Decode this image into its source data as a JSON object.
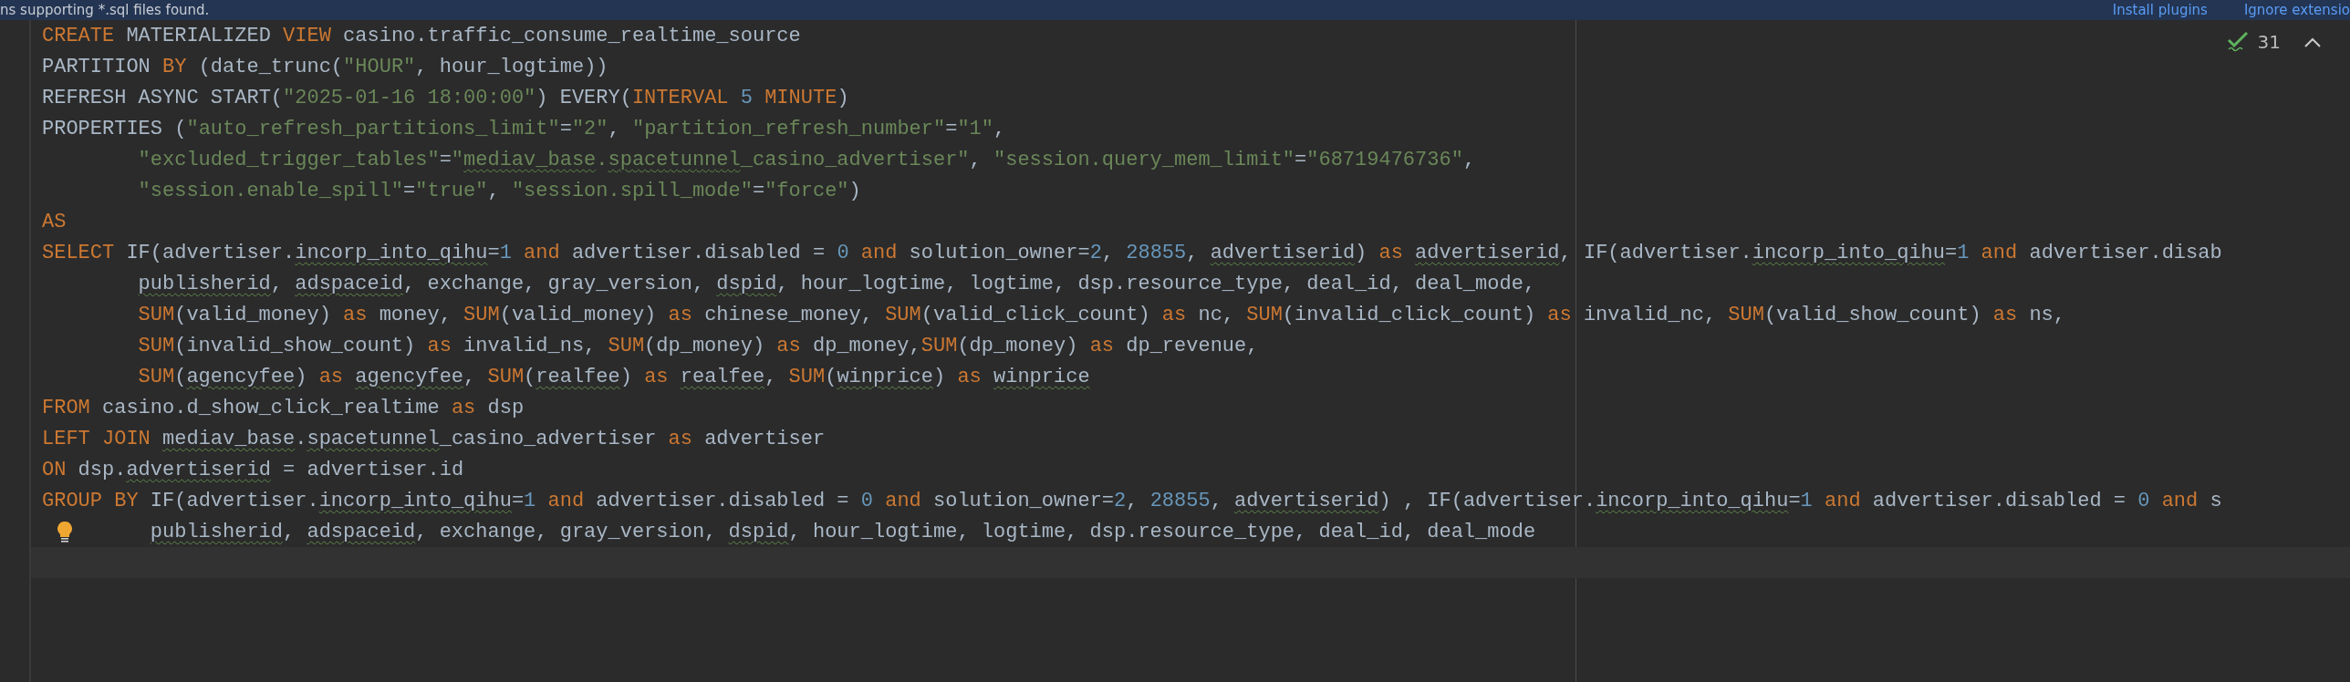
{
  "banner": {
    "message": "ns supporting *.sql files found.",
    "actions": [
      "Install plugins",
      "Ignore extensio"
    ]
  },
  "inspections": {
    "count": "31"
  },
  "lines": [
    {
      "kind": "statement",
      "current": false,
      "hint": false,
      "segments": [
        {
          "kind": "kw",
          "text": "CREATE"
        },
        {
          "kind": "txt",
          "text": " MATERIALIZED "
        },
        {
          "kind": "kw",
          "text": "VIEW"
        },
        {
          "kind": "txt",
          "text": " casino.traffic_consume_realtime_source"
        }
      ]
    },
    {
      "kind": "statement",
      "current": false,
      "hint": false,
      "segments": [
        {
          "kind": "txt",
          "text": "PARTITION "
        },
        {
          "kind": "kw",
          "text": "BY"
        },
        {
          "kind": "txt",
          "text": " (date_trunc("
        },
        {
          "kind": "str",
          "text": "\"HOUR\""
        },
        {
          "kind": "txt",
          "text": ", hour_logtime))"
        }
      ]
    },
    {
      "kind": "statement",
      "current": false,
      "hint": false,
      "segments": [
        {
          "kind": "txt",
          "text": "REFRESH ASYNC START("
        },
        {
          "kind": "str",
          "text": "\"2025-01-16 18:00:00\""
        },
        {
          "kind": "txt",
          "text": ") EVERY("
        },
        {
          "kind": "kw",
          "text": "INTERVAL"
        },
        {
          "kind": "num",
          "text": " 5"
        },
        {
          "kind": "kw",
          "text": " MINUTE"
        },
        {
          "kind": "txt",
          "text": ")"
        }
      ]
    },
    {
      "kind": "statement",
      "current": false,
      "hint": false,
      "segments": [
        {
          "kind": "txt",
          "text": "PROPERTIES ("
        },
        {
          "kind": "str",
          "text": "\"auto_refresh_partitions_limit\""
        },
        {
          "kind": "txt",
          "text": "="
        },
        {
          "kind": "str",
          "text": "\"2\""
        },
        {
          "kind": "txt",
          "text": ", "
        },
        {
          "kind": "str",
          "text": "\"partition_refresh_number\""
        },
        {
          "kind": "txt",
          "text": "="
        },
        {
          "kind": "str",
          "text": "\"1\""
        },
        {
          "kind": "txt",
          "text": ","
        }
      ]
    },
    {
      "kind": "wrapped",
      "current": false,
      "hint": false,
      "segments": [
        {
          "kind": "str",
          "text": "\"excluded_trigger_tables\""
        },
        {
          "kind": "txt",
          "text": "="
        },
        {
          "kind": "str",
          "text": "\""
        },
        {
          "kind": "strwarn",
          "text": "mediav_base"
        },
        {
          "kind": "str",
          "text": "."
        },
        {
          "kind": "strwarn",
          "text": "spacetunnel"
        },
        {
          "kind": "str",
          "text": "_casino_advertiser\""
        },
        {
          "kind": "txt",
          "text": ", "
        },
        {
          "kind": "str",
          "text": "\"session.query_mem_limit\""
        },
        {
          "kind": "txt",
          "text": "="
        },
        {
          "kind": "str",
          "text": "\"68719476736\""
        },
        {
          "kind": "txt",
          "text": ","
        }
      ]
    },
    {
      "kind": "wrapped",
      "current": false,
      "hint": false,
      "segments": [
        {
          "kind": "str",
          "text": "\"session.enable_spill\""
        },
        {
          "kind": "txt",
          "text": "="
        },
        {
          "kind": "str",
          "text": "\"true\""
        },
        {
          "kind": "txt",
          "text": ", "
        },
        {
          "kind": "str",
          "text": "\"session.spill_mode\""
        },
        {
          "kind": "txt",
          "text": "="
        },
        {
          "kind": "str",
          "text": "\"force\""
        },
        {
          "kind": "txt",
          "text": ")"
        }
      ]
    },
    {
      "kind": "statement",
      "current": false,
      "hint": false,
      "segments": [
        {
          "kind": "kw",
          "text": "AS"
        }
      ]
    },
    {
      "kind": "statement",
      "current": false,
      "hint": false,
      "segments": [
        {
          "kind": "kw",
          "text": "SELECT"
        },
        {
          "kind": "txt",
          "text": " IF(advertiser."
        },
        {
          "kind": "warn",
          "text": "incorp_into_qihu"
        },
        {
          "kind": "txt",
          "text": "="
        },
        {
          "kind": "num",
          "text": "1"
        },
        {
          "kind": "kw",
          "text": " and"
        },
        {
          "kind": "txt",
          "text": " advertiser.disabled = "
        },
        {
          "kind": "num",
          "text": "0"
        },
        {
          "kind": "kw",
          "text": " and"
        },
        {
          "kind": "txt",
          "text": " solution_owner="
        },
        {
          "kind": "num",
          "text": "2"
        },
        {
          "kind": "txt",
          "text": ", "
        },
        {
          "kind": "num",
          "text": "28855"
        },
        {
          "kind": "txt",
          "text": ", "
        },
        {
          "kind": "warn",
          "text": "advertiserid"
        },
        {
          "kind": "txt",
          "text": ") "
        },
        {
          "kind": "kw",
          "text": "as "
        },
        {
          "kind": "warn",
          "text": "advertiserid"
        },
        {
          "kind": "txt",
          "text": ", IF(advertiser."
        },
        {
          "kind": "warn",
          "text": "incorp_into_qihu"
        },
        {
          "kind": "txt",
          "text": "="
        },
        {
          "kind": "num",
          "text": "1"
        },
        {
          "kind": "kw",
          "text": " and"
        },
        {
          "kind": "txt",
          "text": " advertiser.disab"
        }
      ]
    },
    {
      "kind": "wrapped",
      "current": false,
      "hint": false,
      "segments": [
        {
          "kind": "warn",
          "text": "publisherid"
        },
        {
          "kind": "txt",
          "text": ", "
        },
        {
          "kind": "warn",
          "text": "adspaceid"
        },
        {
          "kind": "txt",
          "text": ", exchange, gray_version, "
        },
        {
          "kind": "warn",
          "text": "dspid"
        },
        {
          "kind": "txt",
          "text": ", hour_logtime, logtime, dsp.resource_type, deal_id, deal_mode,"
        }
      ]
    },
    {
      "kind": "wrapped",
      "current": false,
      "hint": false,
      "segments": [
        {
          "kind": "kw",
          "text": "SUM"
        },
        {
          "kind": "txt",
          "text": "(valid_money) "
        },
        {
          "kind": "kw",
          "text": "as"
        },
        {
          "kind": "txt",
          "text": " money, "
        },
        {
          "kind": "kw",
          "text": "SUM"
        },
        {
          "kind": "txt",
          "text": "(valid_money) "
        },
        {
          "kind": "kw",
          "text": "as"
        },
        {
          "kind": "txt",
          "text": " chinese_money, "
        },
        {
          "kind": "kw",
          "text": "SUM"
        },
        {
          "kind": "txt",
          "text": "(valid_click_count) "
        },
        {
          "kind": "kw",
          "text": "as"
        },
        {
          "kind": "txt",
          "text": " nc, "
        },
        {
          "kind": "kw",
          "text": "SUM"
        },
        {
          "kind": "txt",
          "text": "(invalid_click_count) "
        },
        {
          "kind": "kw",
          "text": "as"
        },
        {
          "kind": "txt",
          "text": " invalid_nc, "
        },
        {
          "kind": "kw",
          "text": "SUM"
        },
        {
          "kind": "txt",
          "text": "(valid_show_count) "
        },
        {
          "kind": "kw",
          "text": "as"
        },
        {
          "kind": "txt",
          "text": " ns,"
        }
      ]
    },
    {
      "kind": "wrapped",
      "current": false,
      "hint": false,
      "segments": [
        {
          "kind": "kw",
          "text": "SUM"
        },
        {
          "kind": "txt",
          "text": "(invalid_show_count) "
        },
        {
          "kind": "kw",
          "text": "as"
        },
        {
          "kind": "txt",
          "text": " invalid_ns, "
        },
        {
          "kind": "kw",
          "text": "SUM"
        },
        {
          "kind": "txt",
          "text": "(dp_money) "
        },
        {
          "kind": "kw",
          "text": "as"
        },
        {
          "kind": "txt",
          "text": " dp_money,"
        },
        {
          "kind": "kw",
          "text": "SUM"
        },
        {
          "kind": "txt",
          "text": "(dp_money) "
        },
        {
          "kind": "kw",
          "text": "as"
        },
        {
          "kind": "txt",
          "text": " dp_revenue,"
        }
      ]
    },
    {
      "kind": "wrapped",
      "current": false,
      "hint": false,
      "segments": [
        {
          "kind": "kw",
          "text": "SUM"
        },
        {
          "kind": "txt",
          "text": "("
        },
        {
          "kind": "warn",
          "text": "agencyfee"
        },
        {
          "kind": "txt",
          "text": ") "
        },
        {
          "kind": "kw",
          "text": "as "
        },
        {
          "kind": "warn",
          "text": "agencyfee"
        },
        {
          "kind": "txt",
          "text": ", "
        },
        {
          "kind": "kw",
          "text": "SUM"
        },
        {
          "kind": "txt",
          "text": "("
        },
        {
          "kind": "warn",
          "text": "realfee"
        },
        {
          "kind": "txt",
          "text": ") "
        },
        {
          "kind": "kw",
          "text": "as "
        },
        {
          "kind": "warn",
          "text": "realfee"
        },
        {
          "kind": "txt",
          "text": ", "
        },
        {
          "kind": "kw",
          "text": "SUM"
        },
        {
          "kind": "txt",
          "text": "("
        },
        {
          "kind": "warn",
          "text": "winprice"
        },
        {
          "kind": "txt",
          "text": ") "
        },
        {
          "kind": "kw",
          "text": "as "
        },
        {
          "kind": "warn",
          "text": "winprice"
        }
      ]
    },
    {
      "kind": "statement",
      "current": false,
      "hint": false,
      "segments": [
        {
          "kind": "kw",
          "text": "FROM"
        },
        {
          "kind": "txt",
          "text": " casino.d_show_click_realtime "
        },
        {
          "kind": "kw",
          "text": "as"
        },
        {
          "kind": "txt",
          "text": " dsp"
        }
      ]
    },
    {
      "kind": "statement",
      "current": false,
      "hint": false,
      "segments": [
        {
          "kind": "kw",
          "text": "LEFT JOIN "
        },
        {
          "kind": "warn",
          "text": "mediav_base"
        },
        {
          "kind": "txt",
          "text": "."
        },
        {
          "kind": "warn",
          "text": "spacetunnel"
        },
        {
          "kind": "txt",
          "text": "_casino_advertiser "
        },
        {
          "kind": "kw",
          "text": "as"
        },
        {
          "kind": "txt",
          "text": " advertiser"
        }
      ]
    },
    {
      "kind": "statement",
      "current": false,
      "hint": false,
      "segments": [
        {
          "kind": "kw",
          "text": "ON"
        },
        {
          "kind": "txt",
          "text": " dsp."
        },
        {
          "kind": "warn",
          "text": "advertiserid"
        },
        {
          "kind": "txt",
          "text": " = advertiser.id"
        }
      ]
    },
    {
      "kind": "statement",
      "current": false,
      "hint": false,
      "segments": [
        {
          "kind": "kw",
          "text": "GROUP BY"
        },
        {
          "kind": "txt",
          "text": " IF(advertiser."
        },
        {
          "kind": "warn",
          "text": "incorp_into_qihu"
        },
        {
          "kind": "txt",
          "text": "="
        },
        {
          "kind": "num",
          "text": "1"
        },
        {
          "kind": "kw",
          "text": " and"
        },
        {
          "kind": "txt",
          "text": " advertiser.disabled = "
        },
        {
          "kind": "num",
          "text": "0"
        },
        {
          "kind": "kw",
          "text": " and"
        },
        {
          "kind": "txt",
          "text": " solution_owner="
        },
        {
          "kind": "num",
          "text": "2"
        },
        {
          "kind": "txt",
          "text": ", "
        },
        {
          "kind": "num",
          "text": "28855"
        },
        {
          "kind": "txt",
          "text": ", "
        },
        {
          "kind": "warn",
          "text": "advertiserid"
        },
        {
          "kind": "txt",
          "text": ") , IF(advertiser."
        },
        {
          "kind": "warn",
          "text": "incorp_into_qihu"
        },
        {
          "kind": "txt",
          "text": "="
        },
        {
          "kind": "num",
          "text": "1"
        },
        {
          "kind": "kw",
          "text": " and"
        },
        {
          "kind": "txt",
          "text": " advertiser.disabled = "
        },
        {
          "kind": "num",
          "text": "0"
        },
        {
          "kind": "kw",
          "text": " and"
        },
        {
          "kind": "txt",
          "text": " s"
        }
      ]
    },
    {
      "kind": "aligned",
      "current": false,
      "hint": true,
      "segments": [
        {
          "kind": "warn",
          "text": "publisherid"
        },
        {
          "kind": "txt",
          "text": ", "
        },
        {
          "kind": "warn",
          "text": "adspaceid"
        },
        {
          "kind": "txt",
          "text": ", exchange, gray_version, "
        },
        {
          "kind": "warn",
          "text": "dspid"
        },
        {
          "kind": "txt",
          "text": ", hour_logtime, logtime, dsp.resource_type, deal_id, deal_mode"
        }
      ]
    },
    {
      "kind": "statement",
      "current": true,
      "hint": false
    }
  ]
}
